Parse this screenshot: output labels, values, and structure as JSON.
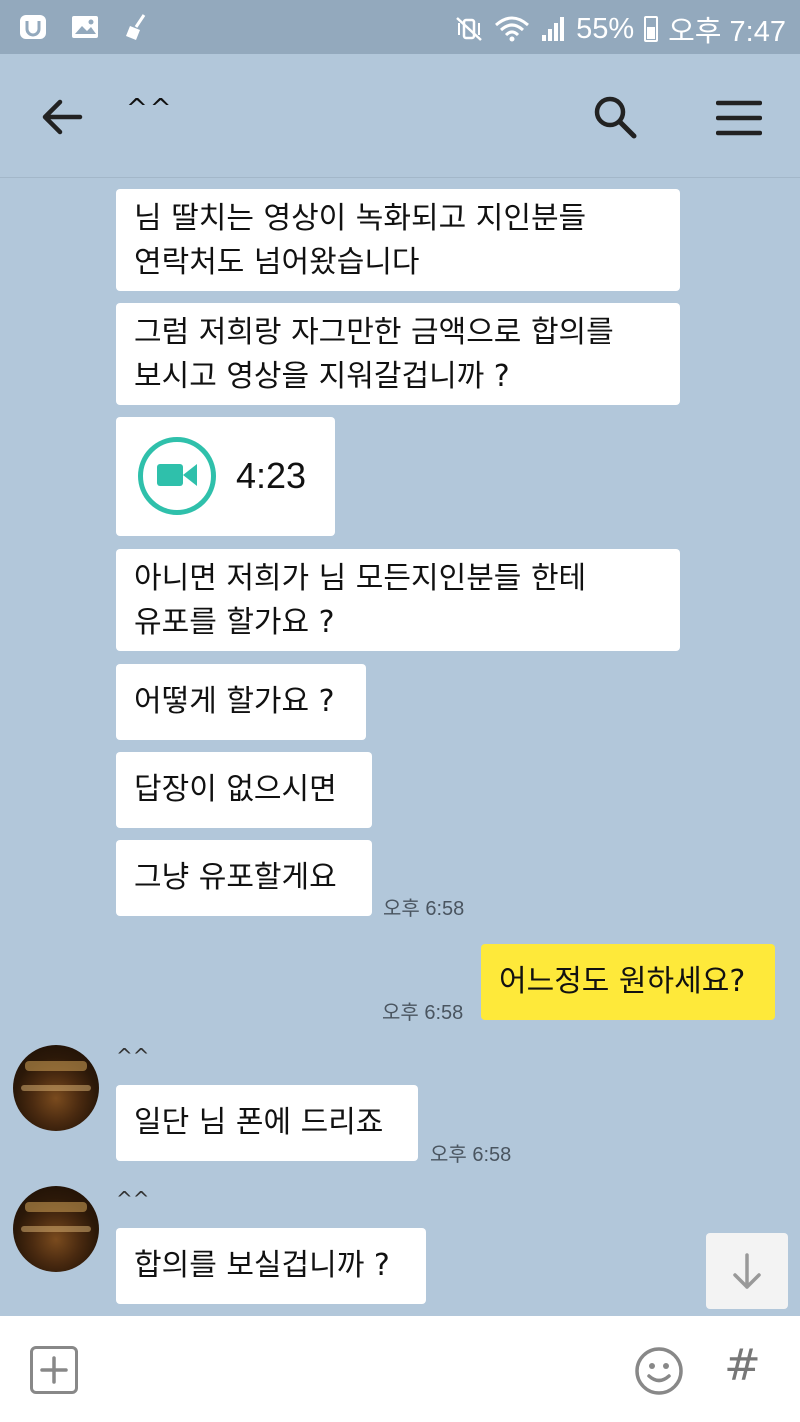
{
  "status_bar": {
    "battery": "55%",
    "time": "오후 7:47",
    "battery_level": 0.55
  },
  "header": {
    "title": "^^"
  },
  "messages": [
    {
      "side": "them",
      "lines": [
        "님 딸치는 영상이 녹화되고 지인분들",
        "연락처도 넘어왔습니다"
      ]
    },
    {
      "side": "them",
      "lines": [
        "그럼 저희랑 자그만한 금액으로 합의를",
        "보시고 영상을 지워갈겁니까 ?"
      ]
    },
    {
      "side": "them",
      "type": "video",
      "duration": "4:23"
    },
    {
      "side": "them",
      "lines": [
        "아니면 저희가 님 모든지인분들 한테",
        "유포를 할가요 ?"
      ]
    },
    {
      "side": "them",
      "text": "어떻게 할가요 ?"
    },
    {
      "side": "them",
      "text": "답장이 없으시면"
    },
    {
      "side": "them",
      "text": "그냥 유포할게요",
      "time": "오후 6:58"
    },
    {
      "side": "me",
      "text": "어느정도 원하세요?",
      "time": "오후 6:58"
    },
    {
      "side": "them",
      "sender": "^^",
      "text": "일단 님 폰에 드리죠",
      "time": "오후 6:58"
    },
    {
      "side": "them",
      "sender": "^^",
      "text": "합의를 보실겁니까 ?"
    }
  ],
  "colors": {
    "chat_background": "#b2c7da",
    "my_bubble": "#fee93a",
    "their_bubble": "#ffffff",
    "video_icon": "#2fc0ab"
  },
  "icons": {
    "back": "arrow-left-icon",
    "search": "search-icon",
    "menu": "hamburger-menu-icon",
    "video": "video-camera-icon",
    "scroll_down": "arrow-down-icon",
    "attach": "plus-icon",
    "emoji": "emoji-icon",
    "hashtag": "hash-icon"
  },
  "input_bar": {
    "hash_label": "#"
  }
}
